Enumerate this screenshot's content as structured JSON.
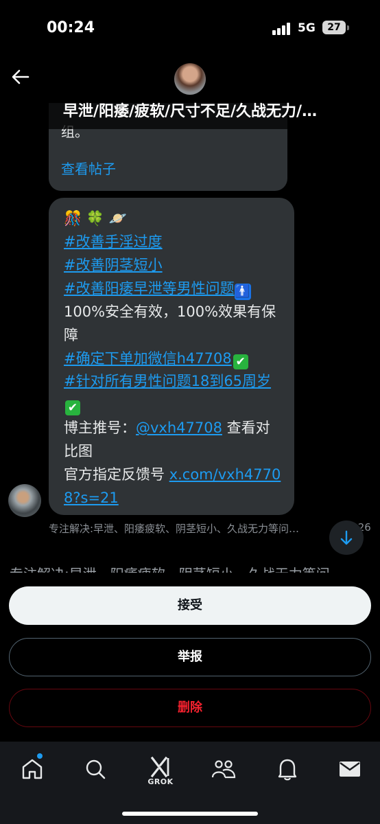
{
  "status": {
    "time": "00:24",
    "network": "5G",
    "battery": "27"
  },
  "header": {
    "title": "早泄/阳痿/疲软/尺寸不足/久战无力/…"
  },
  "bubble1": {
    "cut_text": "组。",
    "link": "查看帖子"
  },
  "message": {
    "emojis": "🎊 🍀 🪐",
    "tag1": "#改善手淫过度",
    "tag2": "#改善阴茎短小",
    "tag3": "#改善阳痿早泄等男性问题",
    "line4": "100%安全有效，100%效果有保障",
    "tag5": "#确定下单加微信h47708",
    "tag6": "#针对所有男性问题18到65周岁",
    "line7_prefix": "博主推号：",
    "handle": "@vxh47708",
    "line7_suffix": " 查看对比图",
    "line8_prefix": "官方指定反馈号 ",
    "link": "x.com/vxh47708?s=21"
  },
  "sender": {
    "label": "专注解决:早泄、阳痿疲软、阴茎短小、久战无力等问…",
    "time": "·26"
  },
  "behind_text": "专注解决:早泄、阳痿疲软、阴茎短小、久战无力等问",
  "actions": {
    "accept": "接受",
    "report": "举报",
    "delete": "删除"
  },
  "tabs": {
    "grok": "GROK"
  },
  "colors": {
    "accent": "#1d9bf0",
    "danger": "#f4212e",
    "bubble": "#2f3336"
  }
}
